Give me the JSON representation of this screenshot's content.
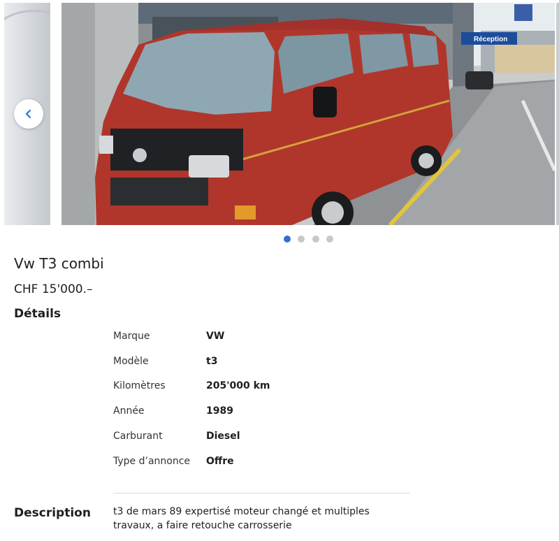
{
  "gallery": {
    "dots": 4,
    "active_index": 0,
    "prev_icon": "chevron-left-icon",
    "street_sign": "Réception"
  },
  "listing": {
    "title": "Vw T3 combi",
    "price": "CHF 15'000.–"
  },
  "details": {
    "heading": "Détails",
    "rows": [
      {
        "label": "Marque",
        "value": "VW"
      },
      {
        "label": "Modèle",
        "value": "t3"
      },
      {
        "label": "Kilomètres",
        "value": "205'000 km"
      },
      {
        "label": "Année",
        "value": "1989"
      },
      {
        "label": "Carburant",
        "value": "Diesel"
      },
      {
        "label": "Type d’annonce",
        "value": "Offre"
      }
    ]
  },
  "description": {
    "heading": "Description",
    "text": "t3 de mars 89 expertisé moteur changé et multiples travaux, a faire retouche carrosserie"
  },
  "colors": {
    "accent": "#2f6fd6",
    "dot_inactive": "#c8c8c8",
    "van": "#b0362b"
  }
}
